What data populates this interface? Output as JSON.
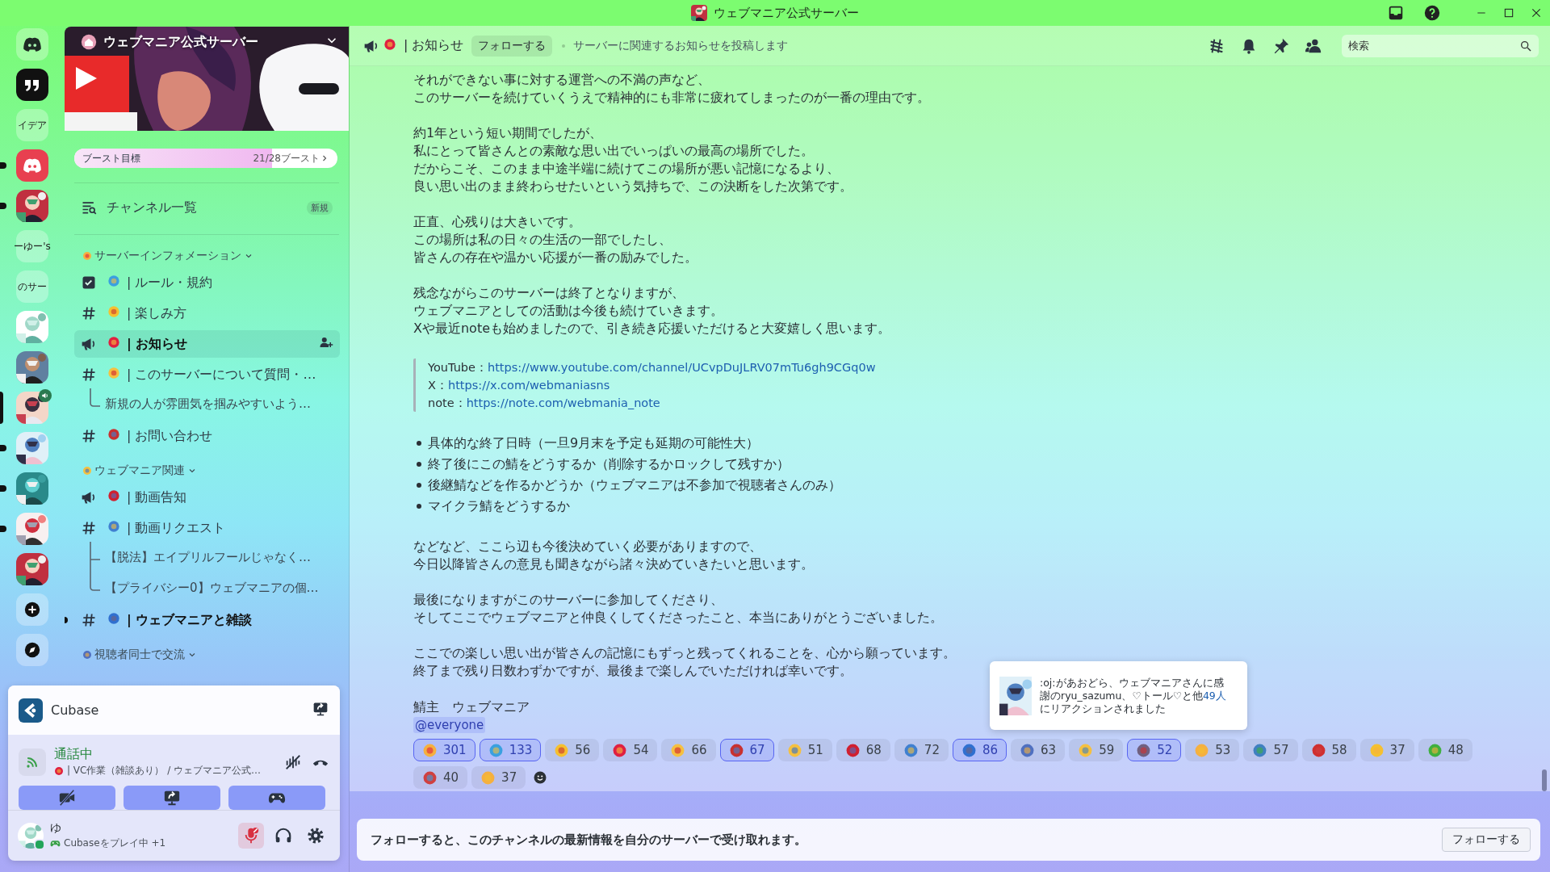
{
  "window": {
    "title": "ウェブマニア公式サーバー"
  },
  "server_rail": [
    {
      "kind": "home",
      "selected": false,
      "unread": false,
      "voice": false
    },
    {
      "kind": "quote",
      "selected": false,
      "unread": false,
      "voice": false
    },
    {
      "kind": "label",
      "label": "イデア",
      "selected": false,
      "unread": false,
      "voice": false
    },
    {
      "kind": "logo",
      "selected": false,
      "unread": true,
      "voice": false
    },
    {
      "kind": "picture",
      "selected": false,
      "unread": true,
      "voice": false
    },
    {
      "kind": "label",
      "label": "ーゆー's",
      "selected": false,
      "unread": false,
      "voice": false
    },
    {
      "kind": "label",
      "label": "のサー",
      "selected": false,
      "unread": false,
      "voice": false
    },
    {
      "kind": "picture",
      "selected": false,
      "unread": false,
      "voice": false
    },
    {
      "kind": "picture",
      "selected": false,
      "unread": false,
      "voice": false
    },
    {
      "kind": "picture",
      "selected": true,
      "unread": false,
      "voice": true
    },
    {
      "kind": "picture",
      "selected": false,
      "unread": true,
      "voice": false
    },
    {
      "kind": "picture",
      "selected": false,
      "unread": true,
      "voice": false
    },
    {
      "kind": "picture",
      "selected": false,
      "unread": true,
      "voice": false
    },
    {
      "kind": "picture",
      "selected": false,
      "unread": false,
      "voice": false
    },
    {
      "kind": "add",
      "selected": false,
      "unread": false,
      "voice": false
    },
    {
      "kind": "explore",
      "selected": false,
      "unread": false,
      "voice": false
    }
  ],
  "sidebar": {
    "server_name": "ウェブマニア公式サーバー",
    "boost": {
      "label": "ブースト目標",
      "progress": "21/28ブースト",
      "level": 0.75
    },
    "browse": {
      "label": "チャンネル一覧",
      "badge": "新規"
    },
    "categories": [
      {
        "name": "サーバーインフォメーション",
        "expanded": true,
        "channels": [
          {
            "kind": "rules",
            "name": "| ルール・規約",
            "selected": false,
            "unread": false
          },
          {
            "kind": "text",
            "name": "| 楽しみ方",
            "selected": false,
            "unread": false
          },
          {
            "kind": "announcement",
            "name": "| お知らせ",
            "selected": true,
            "unread": false
          },
          {
            "kind": "text",
            "name": "| このサーバーについて質問・…",
            "selected": false,
            "unread": false,
            "children": [
              {
                "name": "新規の人が雰囲気を掴みやすいよう…"
              }
            ]
          },
          {
            "kind": "text",
            "name": "| お問い合わせ",
            "selected": false,
            "unread": false
          }
        ]
      },
      {
        "name": "ウェブマニア関連",
        "expanded": true,
        "channels": [
          {
            "kind": "announcement",
            "name": "| 動画告知",
            "selected": false,
            "unread": false
          },
          {
            "kind": "text",
            "name": "| 動画リクエスト",
            "selected": false,
            "unread": false,
            "children": [
              {
                "name": "【脱法】エイプリルフールじゃなく…"
              },
              {
                "name": "【プライバシー0】ウェブマニアの個…"
              }
            ]
          },
          {
            "kind": "text",
            "name": "| ウェブマニアと雑談",
            "selected": false,
            "unread": true
          }
        ]
      },
      {
        "name": "視聴者同士で交流",
        "expanded": true
      }
    ]
  },
  "voice_panel": {
    "activity": "Cubase",
    "status": "通話中",
    "channel": "| VC作業（雑談あり） / ウェブマニア公式…",
    "user": {
      "name": "ゆ",
      "activity": "Cubaseをプレイ中 +1",
      "mic_muted": true
    }
  },
  "header": {
    "channel": "| お知らせ",
    "follow_button": "フォローする",
    "topic": "サーバーに関連するお知らせを投稿します",
    "search": {
      "placeholder": "検索"
    }
  },
  "message": {
    "blocks": [
      {
        "kind": "paragraph",
        "lines": [
          "それができない事に対する運営への不満の声など、",
          "このサーバーを続けていくうえで精神的にも非常に疲れてしまったのが一番の理由です。"
        ]
      },
      {
        "kind": "paragraph",
        "lines": [
          "約1年という短い期間でしたが、",
          "私にとって皆さんとの素敵な思い出でいっぱいの最高の場所でした。",
          "だからこそ、このまま中途半端に続けてこの場所が悪い記憶になるより、",
          "良い思い出のまま終わらせたいという気持ちで、この決断をした次第です。"
        ]
      },
      {
        "kind": "paragraph",
        "lines": [
          "正直、心残りは大きいです。",
          "この場所は私の日々の生活の一部でしたし、",
          "皆さんの存在や温かい応援が一番の励みでした。"
        ]
      },
      {
        "kind": "paragraph",
        "lines": [
          "残念ながらこのサーバーは終了となりますが、",
          "ウェブマニアとしての活動は今後も続けていきます。",
          "Xや最近noteも始めましたので、引き続き応援いただけると大変嬉しく思います。"
        ]
      },
      {
        "kind": "quote",
        "lines": [
          {
            "label": "YouTube：",
            "link": "https://www.youtube.com/channel/UCvpDuJLRV07mTu6gh9CGq0w"
          },
          {
            "label": "X：",
            "link": "https://x.com/webmaniasns"
          },
          {
            "label": "note：",
            "link": "https://note.com/webmania_note"
          }
        ]
      },
      {
        "kind": "list",
        "items": [
          "具体的な終了日時（一旦9月末を予定も延期の可能性大）",
          "終了後にこの鯖をどうするか（削除するかロックして残すか）",
          "後継鯖などを作るかどうか（ウェブマニアは不参加で視聴者さんのみ）",
          "マイクラ鯖をどうするか"
        ]
      },
      {
        "kind": "paragraph",
        "lines": [
          "などなど、ここら辺も今後決めていく必要がありますので、",
          "今日以降皆さんの意見も聞きながら諸々決めていきたいと思います。"
        ]
      },
      {
        "kind": "paragraph",
        "lines": [
          "最後になりますがこのサーバーに参加してくださり、",
          "そしてここでウェブマニアと仲良くしてくださったこと、本当にありがとうございました。"
        ]
      },
      {
        "kind": "paragraph",
        "lines": [
          "ここでの楽しい思い出が皆さんの記憶にもずっと残ってくれることを、心から願っています。",
          "終了まで残り日数わずかですが、最後まで楽しんでいただければ幸いです。"
        ]
      }
    ],
    "author": "鯖主　ウェブマニア",
    "mention": "@everyone",
    "reactions": [
      {
        "count": "301",
        "selected": true
      },
      {
        "count": "133",
        "selected": true
      },
      {
        "count": "56",
        "selected": false
      },
      {
        "count": "54",
        "selected": false
      },
      {
        "count": "66",
        "selected": false
      },
      {
        "count": "67",
        "selected": true
      },
      {
        "count": "51",
        "selected": false
      },
      {
        "count": "68",
        "selected": false
      },
      {
        "count": "72",
        "selected": false
      },
      {
        "count": "86",
        "selected": true
      },
      {
        "count": "63",
        "selected": false
      },
      {
        "count": "59",
        "selected": false
      },
      {
        "count": "52",
        "selected": true
      },
      {
        "count": "53",
        "selected": false
      },
      {
        "count": "57",
        "selected": false
      },
      {
        "count": "58",
        "selected": false
      },
      {
        "count": "37",
        "selected": false
      },
      {
        "count": "48",
        "selected": false
      },
      {
        "count": "40",
        "selected": false
      },
      {
        "count": "37",
        "selected": false
      }
    ]
  },
  "tooltip": {
    "text_before": ":oj:があおどら、ウェブマニアさんに感謝のryu_sazumu、♡トール♡と他",
    "link": "49人",
    "text_after": "にリアクションされました"
  },
  "follow_banner": {
    "text": "フォローすると、このチャンネルの最新情報を自分のサーバーで受け取れます。",
    "button": "フォローする"
  }
}
